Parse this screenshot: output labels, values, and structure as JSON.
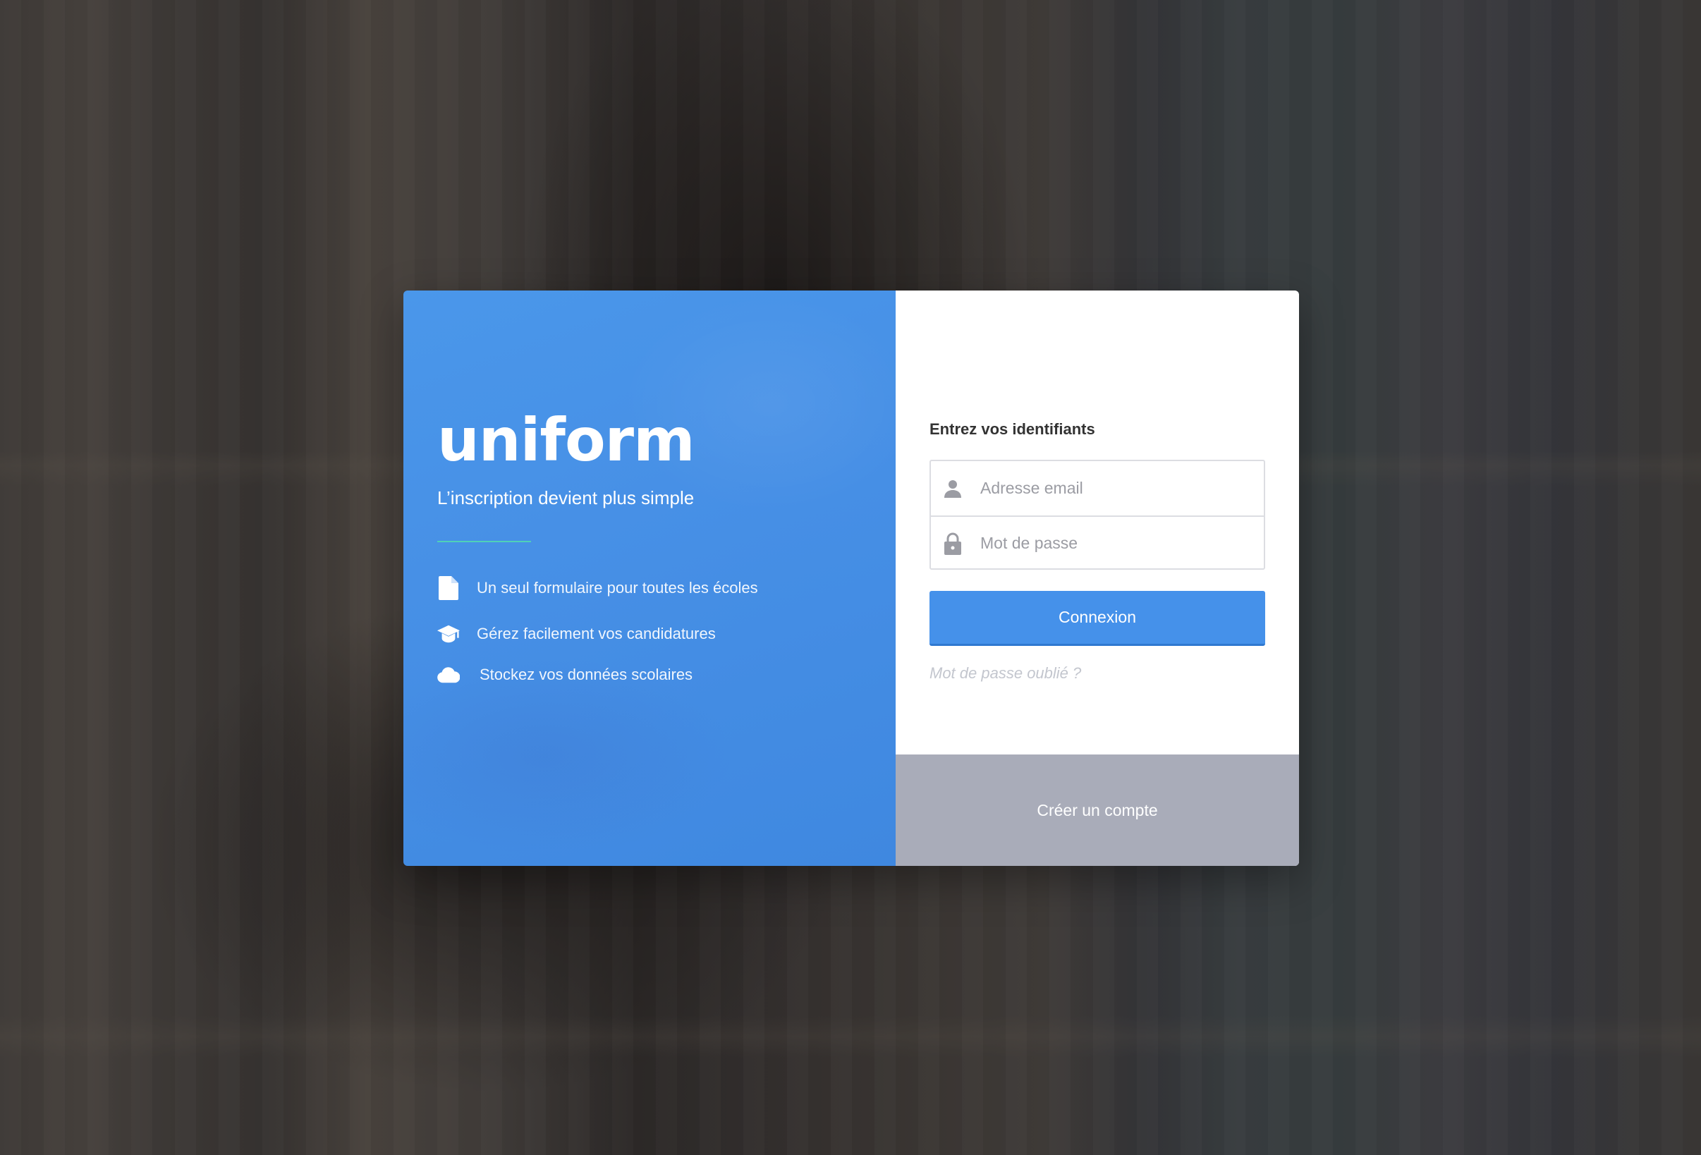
{
  "brand": {
    "name": "uniform",
    "tagline": "L’inscription devient plus simple"
  },
  "features": [
    {
      "icon": "document-icon",
      "label": "Un seul formulaire pour toutes les écoles"
    },
    {
      "icon": "graduation-cap-icon",
      "label": "Gérez facilement vos candidatures"
    },
    {
      "icon": "cloud-icon",
      "label": "Stockez vos données scolaires"
    }
  ],
  "login": {
    "heading": "Entrez vos identifiants",
    "email_placeholder": "Adresse email",
    "password_placeholder": "Mot de passe",
    "submit_label": "Connexion",
    "forgot_label": "Mot de passe oublié ?",
    "create_account_label": "Créer un compte"
  },
  "colors": {
    "primary_blue": "#4591ea",
    "accent_teal": "#4fd1b8",
    "create_account_bg": "#a9acb9",
    "field_icon": "#9b9ca3"
  }
}
